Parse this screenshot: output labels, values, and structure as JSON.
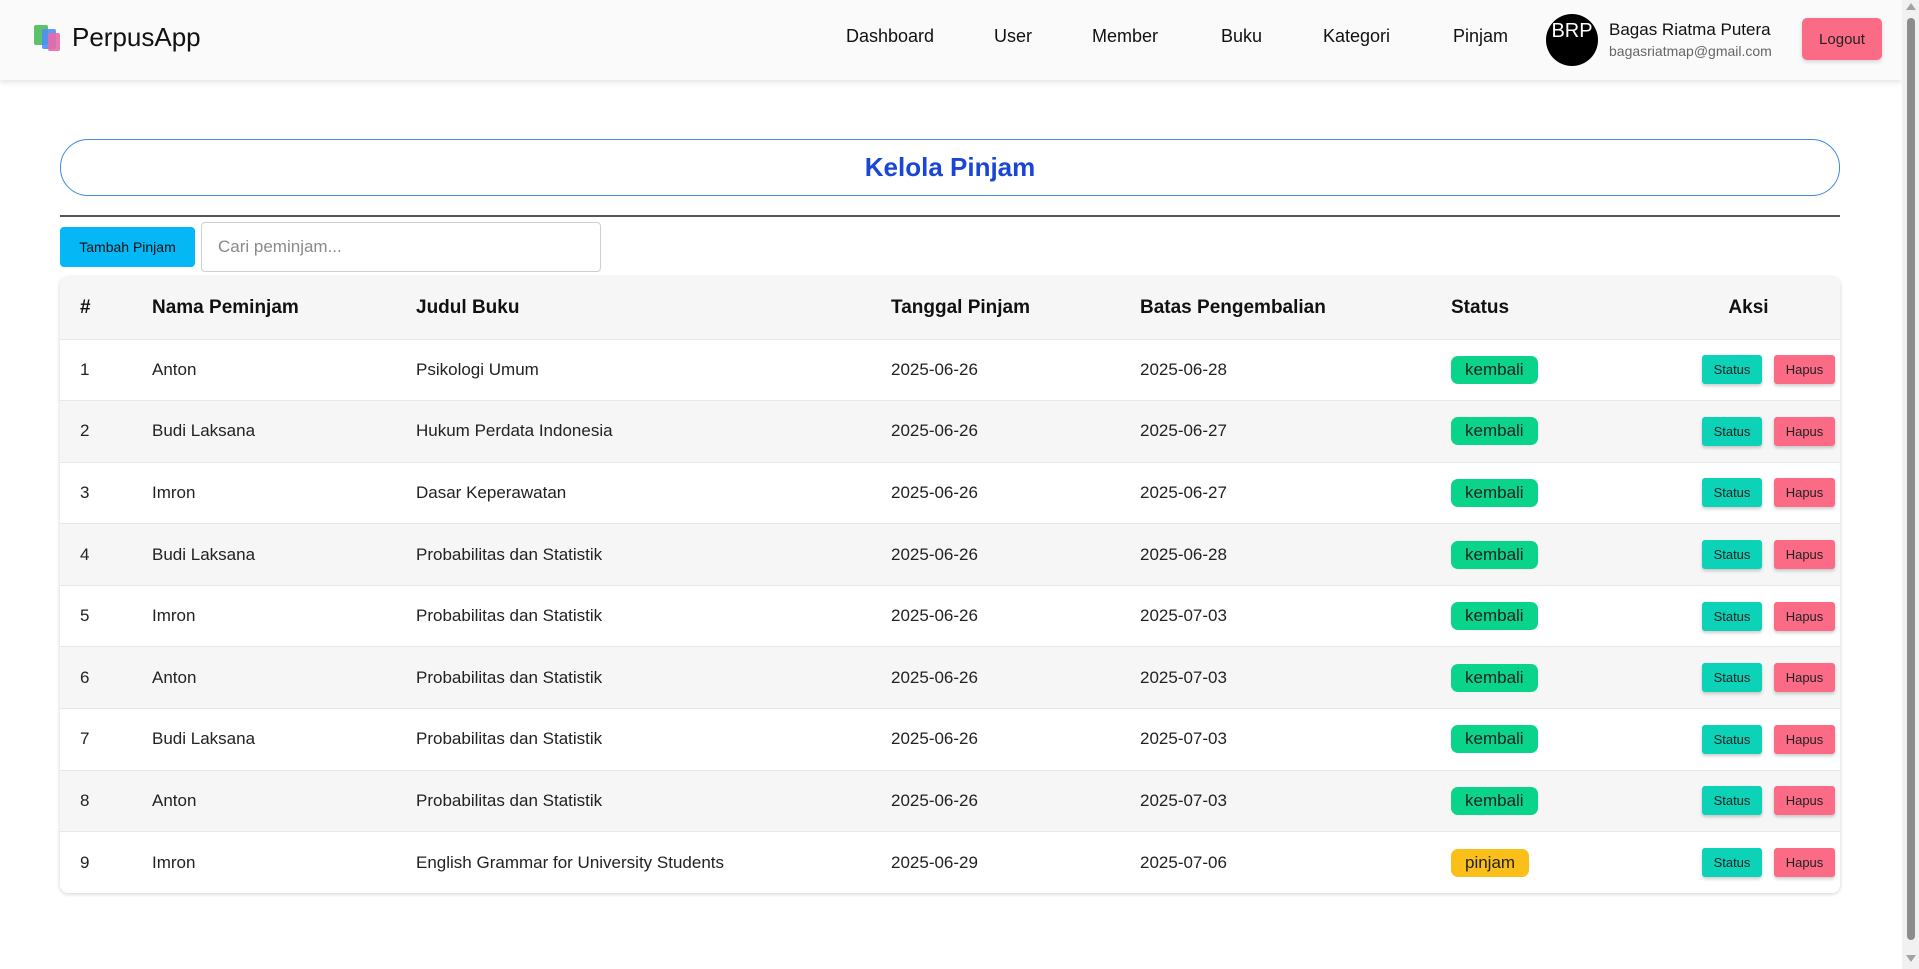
{
  "brand": {
    "name": "PerpusApp"
  },
  "nav": {
    "items": [
      "Dashboard",
      "User",
      "Member",
      "Buku",
      "Kategori",
      "Pinjam"
    ]
  },
  "user": {
    "initials": "BRP",
    "name": "Bagas Riatma Putera",
    "email": "bagasriatmap@gmail.com",
    "logout_label": "Logout"
  },
  "page": {
    "title": "Kelola Pinjam"
  },
  "toolbar": {
    "add_label": "Tambah Pinjam",
    "search_placeholder": "Cari peminjam..."
  },
  "table": {
    "headers": [
      "#",
      "Nama Peminjam",
      "Judul Buku",
      "Tanggal Pinjam",
      "Batas Pengembalian",
      "Status",
      "Aksi"
    ],
    "status_button_label": "Status",
    "delete_button_label": "Hapus",
    "rows": [
      {
        "no": "1",
        "name": "Anton",
        "book": "Psikologi Umum",
        "date": "2025-06-26",
        "due": "2025-06-28",
        "status": "kembali"
      },
      {
        "no": "2",
        "name": "Budi Laksana",
        "book": "Hukum Perdata Indonesia",
        "date": "2025-06-26",
        "due": "2025-06-27",
        "status": "kembali"
      },
      {
        "no": "3",
        "name": "Imron",
        "book": "Dasar Keperawatan",
        "date": "2025-06-26",
        "due": "2025-06-27",
        "status": "kembali"
      },
      {
        "no": "4",
        "name": "Budi Laksana",
        "book": "Probabilitas dan Statistik",
        "date": "2025-06-26",
        "due": "2025-06-28",
        "status": "kembali"
      },
      {
        "no": "5",
        "name": "Imron",
        "book": "Probabilitas dan Statistik",
        "date": "2025-06-26",
        "due": "2025-07-03",
        "status": "kembali"
      },
      {
        "no": "6",
        "name": "Anton",
        "book": "Probabilitas dan Statistik",
        "date": "2025-06-26",
        "due": "2025-07-03",
        "status": "kembali"
      },
      {
        "no": "7",
        "name": "Budi Laksana",
        "book": "Probabilitas dan Statistik",
        "date": "2025-06-26",
        "due": "2025-07-03",
        "status": "kembali"
      },
      {
        "no": "8",
        "name": "Anton",
        "book": "Probabilitas dan Statistik",
        "date": "2025-06-26",
        "due": "2025-07-03",
        "status": "kembali"
      },
      {
        "no": "9",
        "name": "Imron",
        "book": "English Grammar for University Students",
        "date": "2025-06-29",
        "due": "2025-07-06",
        "status": "pinjam"
      }
    ]
  },
  "colors": {
    "title": "#1a46d6",
    "add_button": "#05b7f5",
    "logout_button": "#fb6b85",
    "status_button": "#0cd2b8",
    "delete_button": "#fb6b85",
    "badge_kembali": "#0ad48a",
    "badge_pinjam": "#fbbf1a"
  }
}
